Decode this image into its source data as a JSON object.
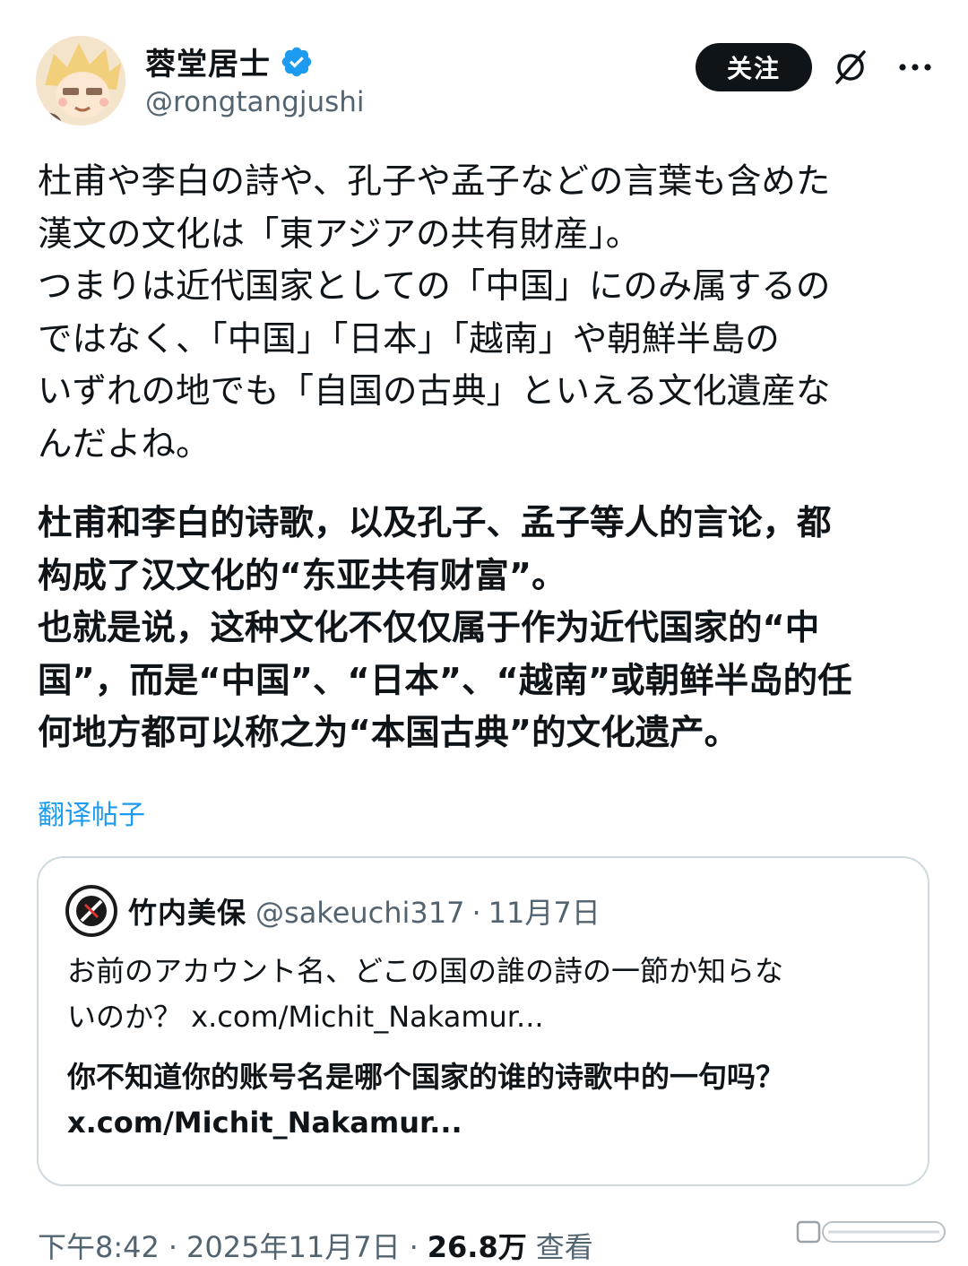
{
  "author": {
    "display_name": "蓉堂居士",
    "handle": "@rongtangjushi",
    "verified": true,
    "avatar": "anime-avatar"
  },
  "actions": {
    "follow_label": "关注",
    "grok_icon": "grok-slash-circle-icon",
    "more_icon": "more-horizontal-icon"
  },
  "post": {
    "text_jp": "杜甫や李白の詩や、孔子や孟子などの言葉も含めた\n漢文の文化は「東アジアの共有財産」。\nつまりは近代国家としての「中国」にのみ属するの\nではなく、「中国」「日本」「越南」や朝鮮半島の\nいずれの地でも「自国の古典」といえる文化遺産な\nんだよね。",
    "text_zh": "杜甫和李白的诗歌，以及孔子、孟子等人的言论，都\n构成了汉文化的“东亚共有财富”。\n也就是说，这种文化不仅仅属于作为近代国家的“中\n国”，而是“中国”、“日本”、“越南”或朝鲜半岛的任\n何地方都可以称之为“本国古典”的文化遗产。",
    "translate_label": "翻译帖子"
  },
  "quoted": {
    "display_name": "竹内美保",
    "handle": "@sakeuchi317",
    "separator": "·",
    "date": "11月7日",
    "text_jp": "お前のアカウント名、どこの国の誰の詩の一節か知らな\nいのか？ x.com/Michit_Nakamur...",
    "text_zh": "你不知道你的账号名是哪个国家的谁的诗歌中的一句吗？\nx.com/Michit_Nakamur..."
  },
  "footer": {
    "time": "下午8:42",
    "separator": "·",
    "date": "2025年11月7日",
    "views_count": "26.8万",
    "views_label": "查看"
  },
  "colors": {
    "text": "#0f1419",
    "muted": "#536471",
    "link": "#1d9bf0",
    "border": "#cfd9de",
    "button": "#0f1419"
  }
}
